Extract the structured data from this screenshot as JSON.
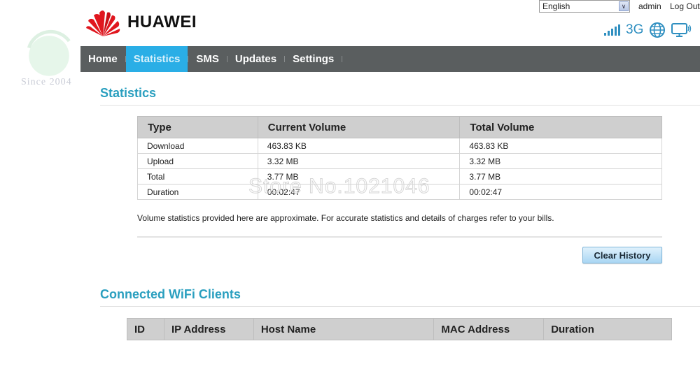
{
  "watermark": {
    "since": "Since 2004",
    "store": "Store No.1021046"
  },
  "brand": {
    "name": "HUAWEI",
    "accent": "#2aaee6",
    "title_color": "#2a9fbf"
  },
  "top_bar": {
    "language": "English",
    "user": "admin",
    "logout": "Log Out",
    "network_type": "3G",
    "icons": [
      "signal-icon",
      "globe-icon",
      "display-icon"
    ]
  },
  "nav": {
    "items": [
      {
        "label": "Home",
        "active": false
      },
      {
        "label": "Statistics",
        "active": true
      },
      {
        "label": "SMS",
        "active": false
      },
      {
        "label": "Updates",
        "active": false
      },
      {
        "label": "Settings",
        "active": false
      }
    ]
  },
  "statistics": {
    "title": "Statistics",
    "columns": [
      "Type",
      "Current Volume",
      "Total Volume"
    ],
    "rows": [
      [
        "Download",
        "463.83 KB",
        "463.83 KB"
      ],
      [
        "Upload",
        "3.32 MB",
        "3.32 MB"
      ],
      [
        "Total",
        "3.77 MB",
        "3.77 MB"
      ],
      [
        "Duration",
        "00:02:47",
        "00:02:47"
      ]
    ],
    "note": "Volume statistics provided here are approximate. For accurate statistics and details of charges refer to your bills.",
    "clear_button": "Clear History"
  },
  "wifi_clients": {
    "title": "Connected WiFi Clients",
    "columns": [
      "ID",
      "IP Address",
      "Host Name",
      "MAC Address",
      "Duration"
    ],
    "rows": []
  }
}
